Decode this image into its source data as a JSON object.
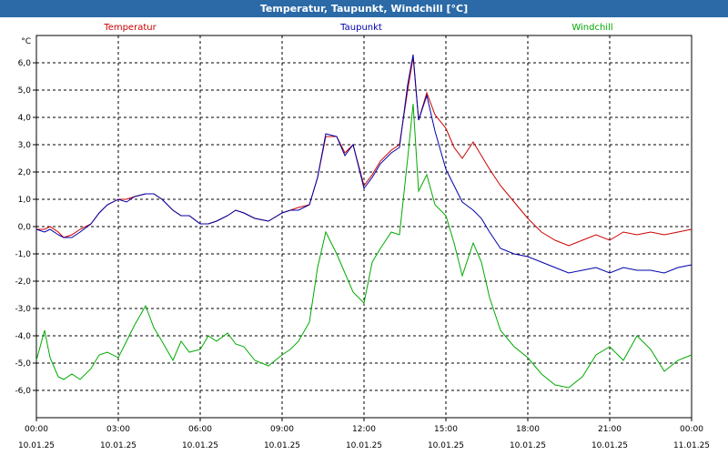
{
  "window": {
    "title": "Temperatur, Taupunkt, Windchill [°C]"
  },
  "chart_data": {
    "type": "line",
    "title": "Temperatur, Taupunkt, Windchill [°C]",
    "ylabel": "°C",
    "ylim": [
      -7,
      7
    ],
    "y_ticks": [
      "6,0",
      "5,0",
      "4,0",
      "3,0",
      "2,0",
      "1,0",
      "0,0",
      "-1,0",
      "-2,0",
      "-3,0",
      "-4,0",
      "-5,0",
      "-6,0"
    ],
    "y_tick_values": [
      6,
      5,
      4,
      3,
      2,
      1,
      0,
      -1,
      -2,
      -3,
      -4,
      -5,
      -6
    ],
    "xlim": [
      0,
      24
    ],
    "x_ticks": [
      {
        "x": 0,
        "time": "00:00",
        "date": "10.01.25"
      },
      {
        "x": 3,
        "time": "03:00",
        "date": "10.01.25"
      },
      {
        "x": 6,
        "time": "06:00",
        "date": "10.01.25"
      },
      {
        "x": 9,
        "time": "09:00",
        "date": "10.01.25"
      },
      {
        "x": 12,
        "time": "12:00",
        "date": "10.01.25"
      },
      {
        "x": 15,
        "time": "15:00",
        "date": "10.01.25"
      },
      {
        "x": 18,
        "time": "18:00",
        "date": "10.01.25"
      },
      {
        "x": 21,
        "time": "21:00",
        "date": "10.01.25"
      },
      {
        "x": 24,
        "time": "00:00",
        "date": "11.01.25"
      }
    ],
    "grid": true,
    "series": [
      {
        "name": "Temperatur",
        "color": "#cc0000",
        "x": [
          0,
          0.3,
          0.5,
          0.8,
          1,
          1.3,
          1.6,
          2,
          2.3,
          2.6,
          3,
          3.3,
          3.6,
          4,
          4.3,
          4.6,
          5,
          5.3,
          5.6,
          6,
          6.3,
          6.6,
          7,
          7.3,
          7.6,
          8,
          8.5,
          9,
          9.3,
          9.6,
          10,
          10.3,
          10.6,
          11,
          11.3,
          11.6,
          12,
          12.3,
          12.6,
          13,
          13.3,
          13.6,
          13.8,
          14,
          14.3,
          14.6,
          15,
          15.3,
          15.6,
          16,
          16.3,
          16.6,
          17,
          17.5,
          18,
          18.5,
          19,
          19.5,
          20,
          20.5,
          21,
          21.5,
          22,
          22.5,
          23,
          23.5,
          24
        ],
        "y": [
          -0.1,
          -0.1,
          0,
          -0.2,
          -0.4,
          -0.3,
          -0.1,
          0.1,
          0.5,
          0.8,
          1.0,
          1.0,
          1.1,
          1.2,
          1.2,
          1.0,
          0.6,
          0.4,
          0.4,
          0.1,
          0.1,
          0.2,
          0.4,
          0.6,
          0.5,
          0.3,
          0.2,
          0.5,
          0.6,
          0.7,
          0.8,
          1.8,
          3.3,
          3.3,
          2.7,
          3.0,
          1.5,
          1.9,
          2.4,
          2.8,
          3.0,
          5.0,
          6.2,
          3.9,
          4.9,
          4.1,
          3.6,
          2.9,
          2.5,
          3.1,
          2.6,
          2.1,
          1.5,
          0.9,
          0.3,
          -0.2,
          -0.5,
          -0.7,
          -0.5,
          -0.3,
          -0.5,
          -0.2,
          -0.3,
          -0.2,
          -0.3,
          -0.2,
          -0.1
        ]
      },
      {
        "name": "Taupunkt",
        "color": "#0000aa",
        "x": [
          0,
          0.3,
          0.5,
          0.8,
          1,
          1.3,
          1.6,
          2,
          2.3,
          2.6,
          3,
          3.3,
          3.6,
          4,
          4.3,
          4.6,
          5,
          5.3,
          5.6,
          6,
          6.3,
          6.6,
          7,
          7.3,
          7.6,
          8,
          8.5,
          9,
          9.3,
          9.6,
          10,
          10.3,
          10.6,
          11,
          11.3,
          11.6,
          12,
          12.3,
          12.6,
          13,
          13.3,
          13.6,
          13.8,
          14,
          14.3,
          14.6,
          15,
          15.3,
          15.6,
          16,
          16.3,
          16.6,
          17,
          17.5,
          18,
          18.5,
          19,
          19.5,
          20,
          20.5,
          21,
          21.5,
          22,
          22.5,
          23,
          23.5,
          24
        ],
        "y": [
          -0.1,
          -0.2,
          -0.1,
          -0.3,
          -0.4,
          -0.4,
          -0.2,
          0.1,
          0.5,
          0.8,
          1.0,
          0.9,
          1.1,
          1.2,
          1.2,
          1.0,
          0.6,
          0.4,
          0.4,
          0.1,
          0.1,
          0.2,
          0.4,
          0.6,
          0.5,
          0.3,
          0.2,
          0.5,
          0.6,
          0.6,
          0.8,
          1.8,
          3.4,
          3.3,
          2.6,
          3.0,
          1.4,
          1.8,
          2.3,
          2.7,
          2.9,
          5.2,
          6.3,
          3.9,
          4.8,
          3.5,
          2.1,
          1.5,
          0.9,
          0.6,
          0.3,
          -0.2,
          -0.8,
          -1.0,
          -1.1,
          -1.3,
          -1.5,
          -1.7,
          -1.6,
          -1.5,
          -1.7,
          -1.5,
          -1.6,
          -1.6,
          -1.7,
          -1.5,
          -1.4
        ]
      },
      {
        "name": "Windchill",
        "color": "#00aa00",
        "x": [
          0,
          0.3,
          0.5,
          0.8,
          1,
          1.3,
          1.6,
          2,
          2.3,
          2.6,
          3,
          3.3,
          3.6,
          4,
          4.3,
          4.6,
          5,
          5.3,
          5.6,
          6,
          6.3,
          6.6,
          7,
          7.3,
          7.6,
          8,
          8.5,
          9,
          9.3,
          9.6,
          10,
          10.3,
          10.6,
          11,
          11.3,
          11.6,
          12,
          12.3,
          12.6,
          13,
          13.3,
          13.6,
          13.8,
          14,
          14.3,
          14.6,
          15,
          15.3,
          15.6,
          16,
          16.3,
          16.6,
          17,
          17.5,
          18,
          18.5,
          19,
          19.5,
          20,
          20.5,
          21,
          21.5,
          22,
          22.5,
          23,
          23.5,
          24
        ],
        "y": [
          -4.9,
          -3.8,
          -4.8,
          -5.5,
          -5.6,
          -5.4,
          -5.6,
          -5.2,
          -4.7,
          -4.6,
          -4.8,
          -4.2,
          -3.6,
          -2.9,
          -3.7,
          -4.2,
          -4.9,
          -4.2,
          -4.6,
          -4.5,
          -4.0,
          -4.2,
          -3.9,
          -4.3,
          -4.4,
          -4.9,
          -5.1,
          -4.7,
          -4.5,
          -4.2,
          -3.5,
          -1.5,
          -0.2,
          -1.0,
          -1.7,
          -2.4,
          -2.8,
          -1.3,
          -0.8,
          -0.2,
          -0.3,
          2.5,
          4.5,
          1.3,
          1.9,
          0.8,
          0.4,
          -0.6,
          -1.8,
          -0.6,
          -1.3,
          -2.6,
          -3.8,
          -4.4,
          -4.8,
          -5.4,
          -5.8,
          -5.9,
          -5.5,
          -4.7,
          -4.4,
          -4.9,
          -4.0,
          -4.5,
          -5.3,
          -4.9,
          -4.7
        ]
      }
    ]
  }
}
